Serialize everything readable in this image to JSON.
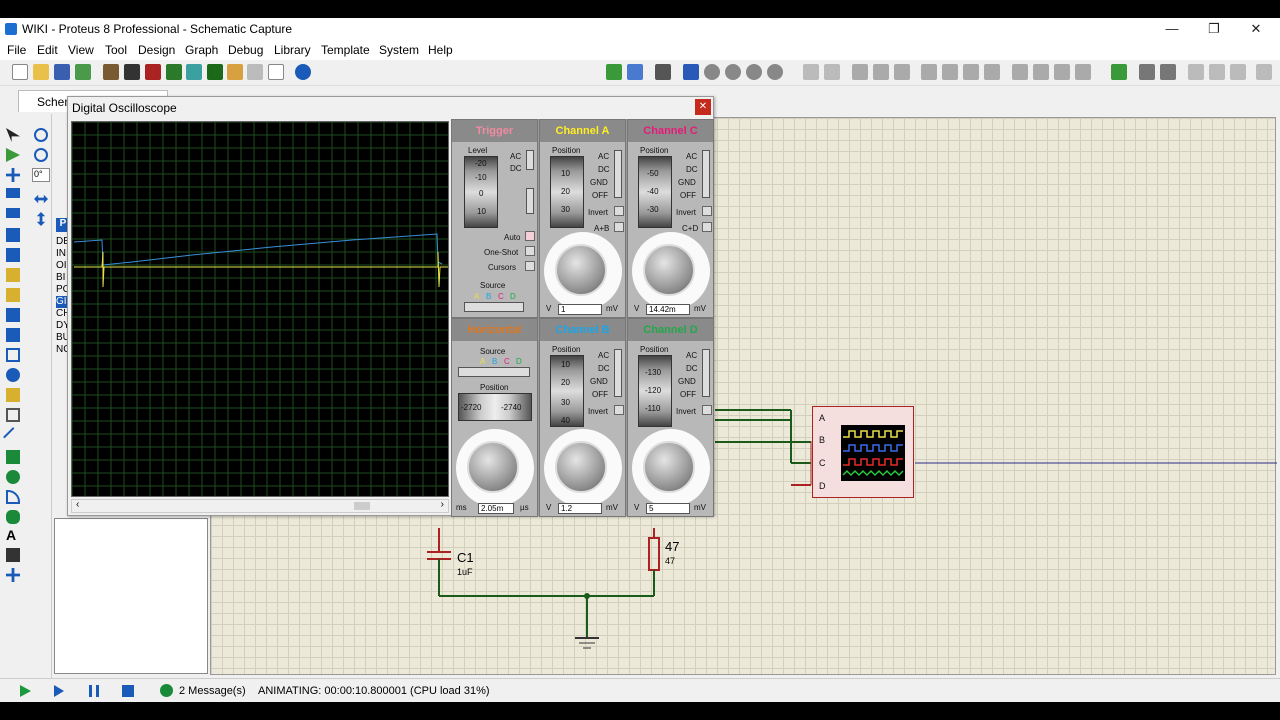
{
  "window": {
    "title": "WIKI - Proteus 8 Professional - Schematic Capture",
    "controls": {
      "minimize": "—",
      "maximize": "❐",
      "close": "✕"
    }
  },
  "menu": [
    "File",
    "Edit",
    "View",
    "Tool",
    "Design",
    "Graph",
    "Debug",
    "Library",
    "Template",
    "System",
    "Help"
  ],
  "tab": {
    "label": "Schematic Capture"
  },
  "left_panel": {
    "rotation": "0°",
    "device_list_letters": [
      "DE",
      "IN",
      "OI",
      "BI",
      "PC",
      "GI",
      "CH",
      "DY",
      "BU",
      "NC"
    ]
  },
  "oscilloscope": {
    "title": "Digital Oscilloscope",
    "trigger": {
      "title": "Trigger",
      "level_label": "Level",
      "level_ticks": [
        "-20",
        "-10",
        "0",
        "10"
      ],
      "coupling": [
        "AC",
        "DC"
      ],
      "modes": [
        "Auto",
        "One-Shot",
        "Cursors"
      ],
      "source_label": "Source",
      "source_letters": [
        "A",
        "B",
        "C",
        "D"
      ]
    },
    "horizontal": {
      "title": "Horizontal",
      "source_label": "Source",
      "source_letters": [
        "A",
        "B",
        "C",
        "D"
      ],
      "position_label": "Position",
      "position_values": [
        "-2720",
        "-2740"
      ],
      "timebase_value": "2.05m",
      "units": [
        "ms",
        "µs"
      ],
      "dial_marks": [
        "0.5",
        "0.2",
        "0.1",
        "1",
        "2",
        "5",
        "10",
        "20",
        "50",
        "100",
        "200"
      ]
    },
    "channels": [
      {
        "name": "Channel A",
        "color": "#ffee22",
        "position_label": "Position",
        "ticks": [
          "10",
          "20",
          "30"
        ],
        "coupling": [
          "AC",
          "DC",
          "GND",
          "OFF"
        ],
        "invert": "Invert",
        "extra": "A+B",
        "value": "1",
        "units": [
          "V",
          "mV"
        ]
      },
      {
        "name": "Channel C",
        "color": "#e8197a",
        "position_label": "Position",
        "ticks": [
          "-50",
          "-40",
          "-30"
        ],
        "coupling": [
          "AC",
          "DC",
          "GND",
          "OFF"
        ],
        "invert": "Invert",
        "extra": "C+D",
        "value": "14.42m",
        "units": [
          "V",
          "mV"
        ]
      },
      {
        "name": "Channel B",
        "color": "#1aa5e8",
        "position_label": "Position",
        "ticks": [
          "10",
          "20",
          "30",
          "40"
        ],
        "coupling": [
          "AC",
          "DC",
          "GND",
          "OFF"
        ],
        "invert": "Invert",
        "value": "1.2",
        "units": [
          "V",
          "mV"
        ]
      },
      {
        "name": "Channel D",
        "color": "#22a84a",
        "position_label": "Position",
        "ticks": [
          "-130",
          "-120",
          "-110"
        ],
        "coupling": [
          "AC",
          "DC",
          "GND",
          "OFF"
        ],
        "invert": "Invert",
        "value": "5",
        "units": [
          "V",
          "mV"
        ]
      }
    ],
    "volt_dial_marks": [
      "0.5",
      "0.2",
      "0.1",
      "1",
      "2",
      "5",
      "10",
      "20",
      "50"
    ]
  },
  "schematic": {
    "capacitor": {
      "ref": "C1",
      "value": "1uF"
    },
    "resistor": {
      "ref": "47",
      "value": "47"
    },
    "osc_pins": [
      "A",
      "B",
      "C",
      "D"
    ]
  },
  "status": {
    "messages": "2 Message(s)",
    "text": "ANIMATING: 00:00:10.800001 (CPU load 31%)"
  },
  "colors": {
    "trace_blue": "#3a8fd8",
    "trace_yellow": "#e8e04a",
    "trigger_pink": "#f08aa0",
    "horizontal_orange": "#e07820",
    "grid_green": "#1e4d1e"
  }
}
